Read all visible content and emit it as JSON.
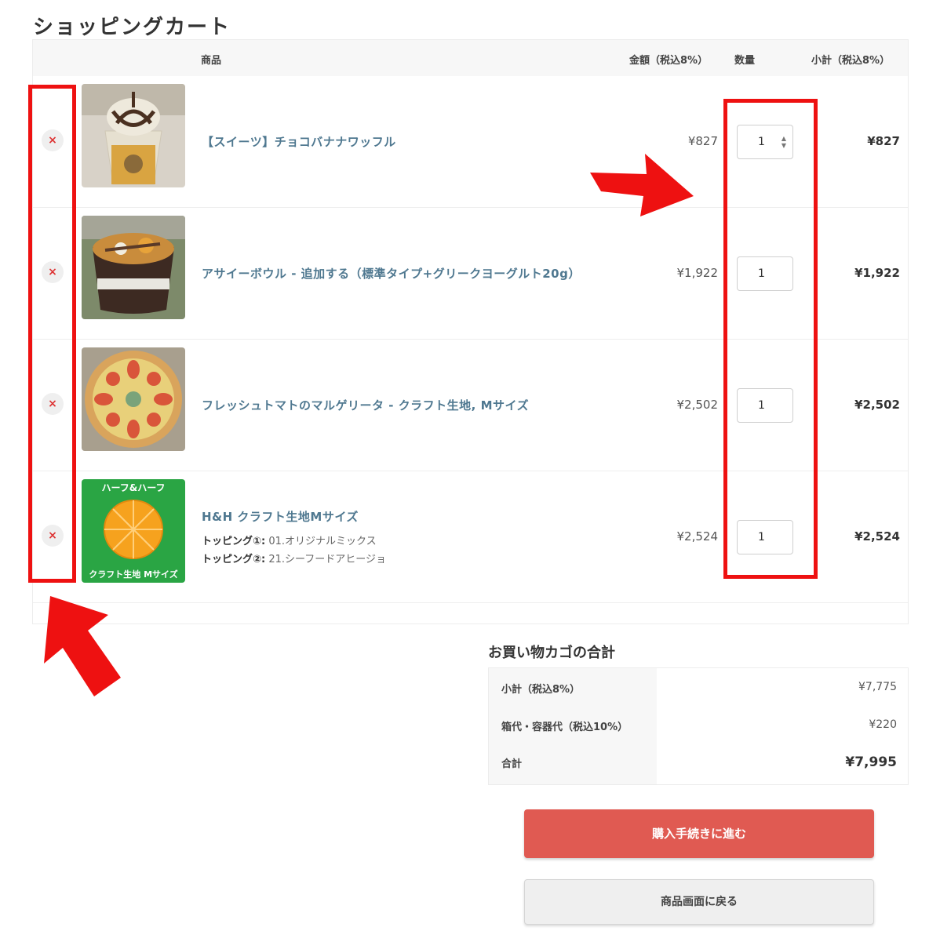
{
  "page": {
    "title": "ショッピングカート"
  },
  "table": {
    "col_product": "商品",
    "col_price": "金額（税込8%）",
    "col_qty": "数量",
    "col_subtotal": "小計（税込8%）"
  },
  "items": [
    {
      "name": "【スイーツ】チョコバナナワッフル",
      "price": "¥827",
      "qty": "1",
      "subtotal": "¥827",
      "remove": "×"
    },
    {
      "name": "アサイーボウル - 追加する（標準タイプ+グリークヨーグルト20g）",
      "price": "¥1,922",
      "qty": "1",
      "subtotal": "¥1,922",
      "remove": "×"
    },
    {
      "name": "フレッシュトマトのマルゲリータ - クラフト生地, Mサイズ",
      "price": "¥2,502",
      "qty": "1",
      "subtotal": "¥2,502",
      "remove": "×"
    },
    {
      "name": "H&H クラフト生地Mサイズ",
      "price": "¥2,524",
      "qty": "1",
      "subtotal": "¥2,524",
      "remove": "×",
      "toppings": [
        {
          "label": "トッピング①:",
          "value": "01.オリジナルミックス"
        },
        {
          "label": "トッピング②:",
          "value": "21.シーフードアヒージョ"
        }
      ],
      "image_text_top": "ハーフ&ハーフ",
      "image_text_bottom": "クラフト生地 Mサイズ"
    }
  ],
  "summary": {
    "title": "お買い物カゴの合計",
    "subtotal_label": "小計（税込8%）",
    "subtotal_value": "¥7,775",
    "box_fee_label": "箱代・容器代（税込10%）",
    "box_fee_value": "¥220",
    "total_label": "合計",
    "total_value": "¥7,995"
  },
  "buttons": {
    "checkout": "購入手続きに進む",
    "back": "商品画面に戻る"
  },
  "colors": {
    "accent_red": "#e05a52",
    "link_blue": "#4f7890",
    "annotation_red": "#ee1111"
  }
}
